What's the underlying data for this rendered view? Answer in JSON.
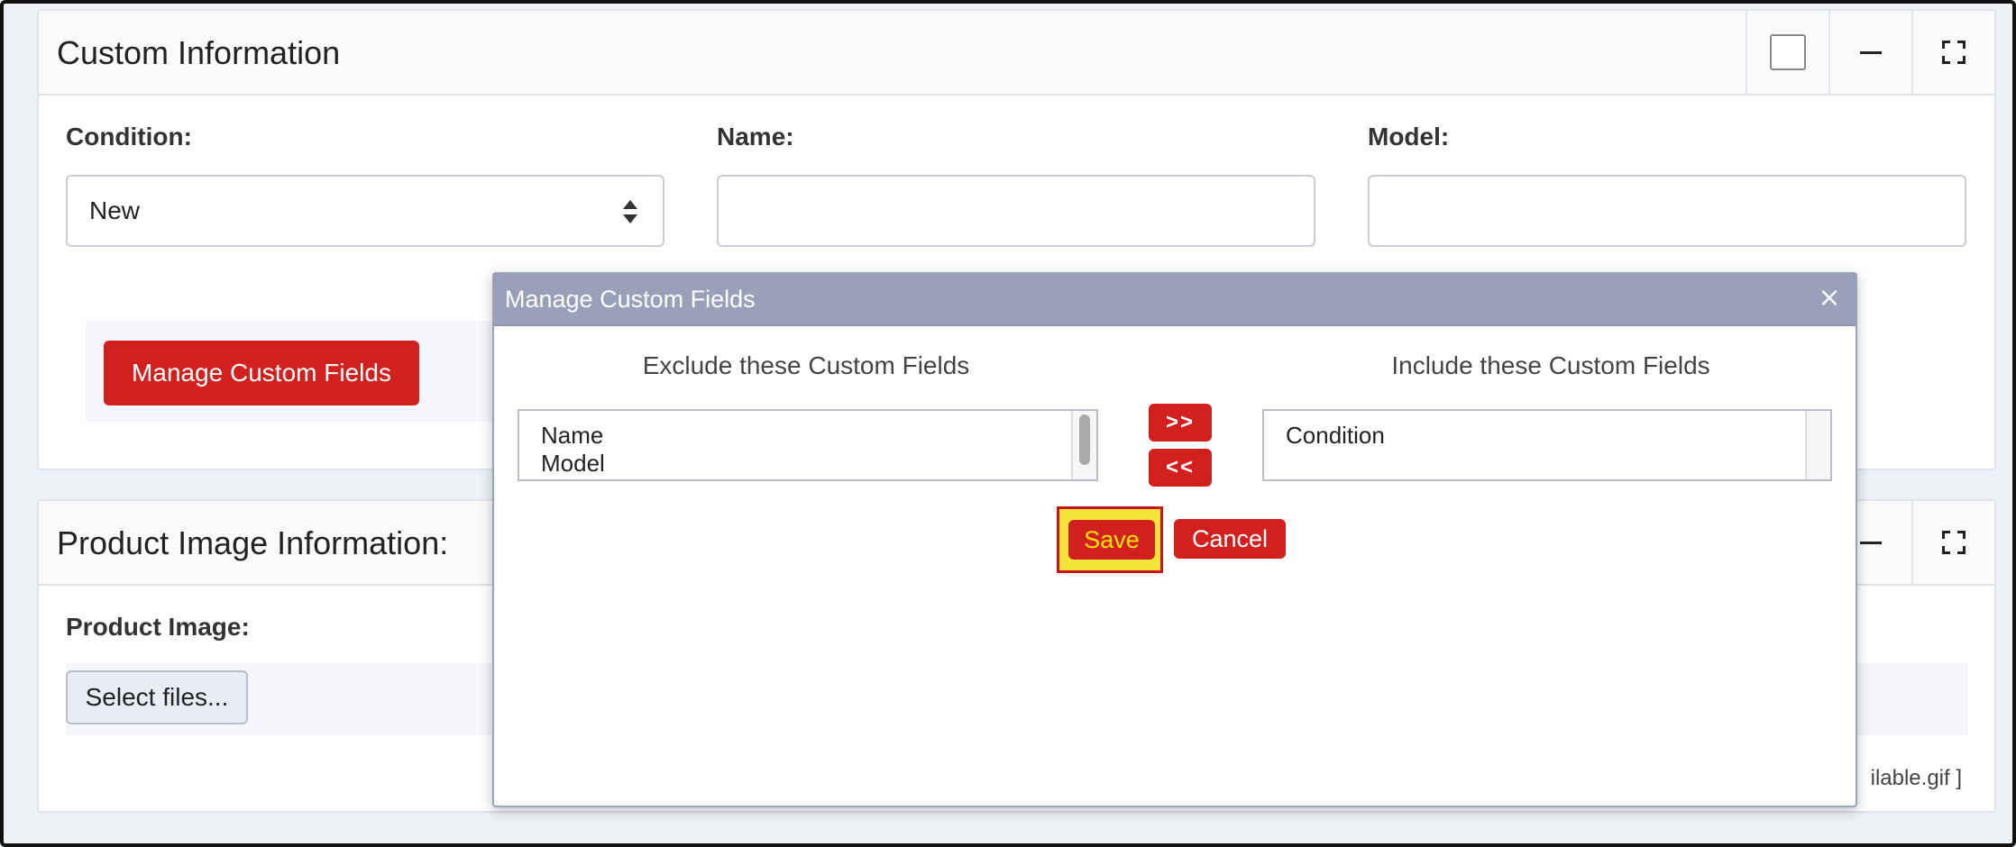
{
  "custom_card": {
    "title": "Custom Information",
    "fields": {
      "condition_label": "Condition:",
      "condition_value": "New",
      "name_label": "Name:",
      "name_value": "",
      "model_label": "Model:",
      "model_value": ""
    },
    "manage_button": "Manage Custom Fields",
    "tools": {
      "minimize_icon": "minus-icon",
      "fullscreen_icon": "expand-icon"
    }
  },
  "product_card": {
    "title": "Product Image Information:",
    "image_label": "Product Image:",
    "select_files": "Select files...",
    "file_note": "ilable.gif ]"
  },
  "dialog": {
    "title": "Manage Custom Fields",
    "close": "×",
    "exclude_heading": "Exclude these Custom Fields",
    "include_heading": "Include these Custom Fields",
    "exclude_items": [
      "Name",
      "Model"
    ],
    "include_items": [
      "Condition"
    ],
    "add_button": ">>",
    "remove_button": "<<",
    "save_button": "Save",
    "cancel_button": "Cancel"
  },
  "colors": {
    "accent_red": "#d2201f",
    "dialog_title_bg": "#98a1b9",
    "highlight": "#f5e43a"
  }
}
